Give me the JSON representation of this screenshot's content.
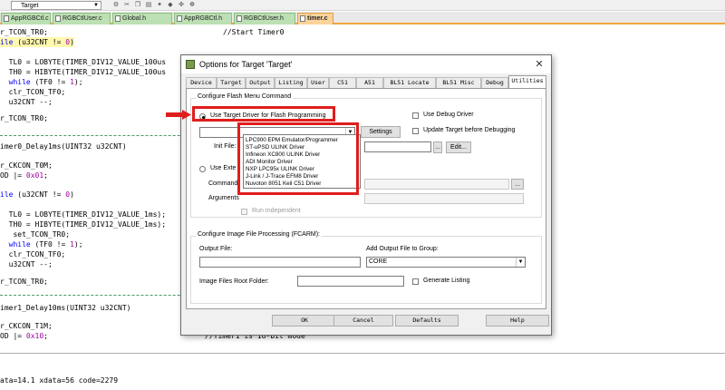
{
  "toolbar": {
    "target_value": "Target"
  },
  "file_tabs": [
    {
      "label": "AppRGBCtl.c",
      "active": false
    },
    {
      "label": "RGBCtlUser.c",
      "active": false
    },
    {
      "label": "Global.h",
      "active": false
    },
    {
      "label": "AppRGBCtl.h",
      "active": false
    },
    {
      "label": "RGBCtlUser.h",
      "active": false
    },
    {
      "label": "timer.c",
      "active": true
    }
  ],
  "code_lines": [
    "r_TCON_TR0;",
    "ile (u32CNT != 0)",
    "",
    "  TL0 = LOBYTE(TIMER_DIV12_VALUE_100us",
    "  TH0 = HIBYTE(TIMER_DIV12_VALUE_100us",
    "  while (TF0 != 1);",
    "  clr_TCON_TF0;",
    "  u32CNT --;",
    "",
    "r_TCON_TR0;",
    "",
    "",
    "imer0_Delay1ms(UINT32 u32CNT)",
    "",
    "r_CKCON_T0M;",
    "OD |= 0x01;",
    "",
    "ile (u32CNT != 0)",
    "",
    "  TL0 = LOBYTE(TIMER_DIV12_VALUE_1ms);",
    "  TH0 = HIBYTE(TIMER_DIV12_VALUE_1ms);",
    "   set_TCON_TR0;",
    "  while (TF0 != 1);",
    "  clr_TCON_TF0;",
    "  u32CNT --;",
    "",
    "r_TCON_TR0;",
    "",
    "",
    "imer1_Delay10ms(UINT32 u32CNT)",
    "",
    "r_CKCON_T1M;",
    "OD |= 0x10;"
  ],
  "code_comments": {
    "start_timer0": "//Start Timer0",
    "timer1_16bit": "//Timer1 is 16-bit mode"
  },
  "output_lines": [
    "ata=14.1 xdata=56 code=2279"
  ],
  "dialog": {
    "title": "Options for Target 'Target'",
    "close": "✕",
    "tabs": [
      "Device",
      "Target",
      "Output",
      "Listing",
      "User",
      "C51",
      "A51",
      "BL51 Locate",
      "BL51 Misc",
      "Debug",
      "Utilities"
    ],
    "active_tab": "Utilities",
    "flash_group_title": "Configure Flash Menu Command",
    "use_target_driver_label": "Use Target Driver for Flash Programming",
    "use_debug_driver_label": "Use Debug Driver",
    "update_target_label": "Update Target before Debugging",
    "settings_label": "Settings",
    "init_file_label": "Init File:",
    "edit_label": "Edit...",
    "browse_label": "...",
    "use_external_label": "Use Exte",
    "command_label": "Command",
    "arguments_label": "Arguments",
    "run_independent_label": "Run Independent",
    "driver_options": [
      "LPC900 EPM Emulator/Programmer",
      "ST-uPSD ULINK Driver",
      "Infineon XC800 ULINK Driver",
      "ADI Monitor Driver",
      "NXP LPC95x ULINK Driver",
      "J-Link / J-Trace EFM8 Driver",
      "Nuvoton 8051 Keil C51 Driver"
    ],
    "image_group_title": "Configure Image File Processing (FCARM):",
    "output_file_label": "Output File:",
    "add_output_label": "Add Output File  to Group:",
    "group_value": "CORE",
    "image_root_label": "Image Files Root Folder:",
    "generate_listing_label": "Generate Listing",
    "ok_label": "OK",
    "cancel_label": "Cancel",
    "defaults_label": "Defaults",
    "help_label": "Help"
  },
  "colors": {
    "keyword": "#0000ff",
    "comment": "#008000",
    "annotation": "#e01d1d"
  }
}
